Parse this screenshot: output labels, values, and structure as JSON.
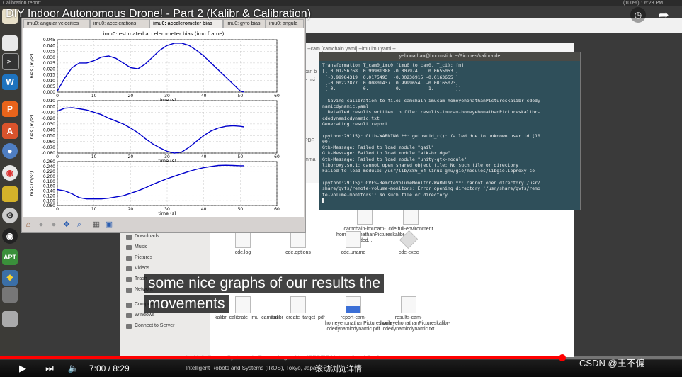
{
  "top_panel": {
    "title": "Calibration report",
    "right_status": "(100%)  ↕  6:23 PM"
  },
  "video": {
    "title": "DIY Indoor Autonomous Drone! - Part 2 (Kalibr & Calibration)",
    "subtitle_line1": "some nice graphs of our results the",
    "subtitle_line2": "movements",
    "time": "7:00 / 8:29",
    "progress": 0.825,
    "cn_caption": "滚动浏览详情",
    "watermark": "CSDN @王不偏"
  },
  "plot_window": {
    "tabs": [
      "imu0: angular velocities",
      "imu0: accelerations",
      "imu0: accelerometer bias",
      "imu0: gyro bias",
      "imu0: angula"
    ],
    "active_tab": 2,
    "toolbar_icons": [
      "home-icon",
      "back-icon",
      "forward-icon",
      "pan-icon",
      "zoom-icon",
      "subplots-icon",
      "save-icon"
    ]
  },
  "terminal": {
    "title": "yehonathan@boomstick: ~/Pictures/kalibr-cde",
    "lines": [
      "Transformation T_cam0_imu0 (imu0 to cam0, T_ci): [m]",
      "[[ 0.01756768  0.99981388 -0.007974    0.0655053 ]",
      " [-0.99984319  0.0175493  -0.00236915 -0.0163655 ]",
      " [-0.00222877  0.00801437  0.9999654  -0.00165073]",
      " [ 0.          0.          0.          1.        ]]",
      "",
      "  Saving calibration to file: camchain-imucam-homeyehonathanPictureskalibr-cdedy",
      "namicdynamic.yaml",
      "  Detailed results written to file: results-imucam-homeyehonathanPictureskalibr-",
      "cdedynamicdynamic.txt",
      "Generating result report...",
      "",
      "(python:29115): GLib-WARNING **: getpwuid_r(): failed due to unknown user id (10",
      "00)",
      "Gtk-Message: Failed to load module \"gail\"",
      "Gtk-Message: Failed to load module \"atk-bridge\"",
      "Gtk-Message: Failed to load module \"unity-gtk-module\"",
      "libproxy.so.1: cannot open shared object file: No such file or directory",
      "Failed to load module: /usr/lib/x86_64-linux-gnu/gio/modules/libgiolibproxy.so",
      "",
      "(python:29115): GVFS-RemoteVolumeMonitor-WARNING **: cannot open directory /usr/",
      "share/gvfs/remote-volume-monitors: Error opening directory '/usr/share/gvfs/remo",
      "te-volume-monitors': No such file or directory",
      "▌"
    ]
  },
  "file_manager": {
    "sidebar": [
      "Downloads",
      "Music",
      "Pictures",
      "Videos",
      "Trash",
      "Network",
      "Computer",
      "Windows",
      "Connect to Server"
    ],
    "files": [
      {
        "name": "camchain-imucam-homeyehonathanPictureskalibr-cded..."
      },
      {
        "name": "cde.full-environment"
      },
      {
        "name": "cde.log"
      },
      {
        "name": "cde.options"
      },
      {
        "name": "cde.uname"
      },
      {
        "name": "cde-exec"
      },
      {
        "name": "kalibr_calibrate_imu_camera"
      },
      {
        "name": "kalibr_create_target_pdf"
      },
      {
        "name": "report-cam-homeyehonathanPictureskalibr-cdedynamicdynamic.pdf"
      },
      {
        "name": "results-cam-homeyehonathanPictureskalibr-cdedynamicdynamic.txt"
      }
    ]
  },
  "web_snippets": [
    "--cam [camchain.yaml] --imu imu.yaml --",
    "can b",
    "e usi",
    "PDF",
    "mma"
  ],
  "footer_text": [
    "for Multi-Sensor Systems. In Proceedings of the IEEE/RSJ International Conference on",
    "Intelligent Robots and Systems (IROS), Tokyo, Japan"
  ],
  "chart_data": {
    "type": "line",
    "title": "imu0: estimated accelerometer bias (imu frame)",
    "color": "#0000cc",
    "subplots": [
      {
        "ylabel": "bias (m/s²)",
        "xlabel": "time (s)",
        "xlim": [
          0,
          60
        ],
        "ylim": [
          0.0,
          0.045
        ],
        "yticks": [
          0.0,
          0.005,
          0.01,
          0.015,
          0.02,
          0.025,
          0.03,
          0.035,
          0.04,
          0.045
        ],
        "xticks": [
          0,
          10,
          20,
          30,
          40,
          50,
          60
        ],
        "x": [
          0,
          2,
          4,
          6,
          8,
          10,
          12,
          14,
          16,
          18,
          20,
          22,
          24,
          26,
          28,
          30,
          32,
          34,
          36,
          38,
          40,
          42,
          44,
          46,
          48,
          50,
          51
        ],
        "y": [
          0.001,
          0.012,
          0.021,
          0.025,
          0.025,
          0.027,
          0.03,
          0.031,
          0.029,
          0.025,
          0.021,
          0.02,
          0.024,
          0.03,
          0.036,
          0.04,
          0.042,
          0.042,
          0.04,
          0.036,
          0.031,
          0.025,
          0.019,
          0.013,
          0.007,
          0.001,
          0.0
        ]
      },
      {
        "ylabel": "bias (m/s²)",
        "xlabel": "time (s)",
        "xlim": [
          0,
          60
        ],
        "ylim": [
          -0.08,
          0.01
        ],
        "yticks": [
          0.01,
          0.0,
          -0.01,
          -0.02,
          -0.03,
          -0.04,
          -0.05,
          -0.06,
          -0.07,
          -0.08
        ],
        "xticks": [
          0,
          10,
          20,
          30,
          40,
          50,
          60
        ],
        "x": [
          0,
          2,
          4,
          6,
          8,
          10,
          12,
          14,
          16,
          18,
          20,
          22,
          24,
          26,
          28,
          30,
          32,
          34,
          36,
          38,
          40,
          42,
          44,
          46,
          48,
          50,
          51
        ],
        "y": [
          -0.008,
          -0.003,
          -0.002,
          -0.004,
          -0.006,
          -0.01,
          -0.014,
          -0.02,
          -0.025,
          -0.03,
          -0.037,
          -0.045,
          -0.055,
          -0.064,
          -0.071,
          -0.077,
          -0.08,
          -0.078,
          -0.07,
          -0.06,
          -0.05,
          -0.042,
          -0.037,
          -0.034,
          -0.033,
          -0.034,
          -0.035
        ]
      },
      {
        "ylabel": "bias (m/s²)",
        "xlabel": "time (s)",
        "xlim": [
          0,
          60
        ],
        "ylim": [
          0.08,
          0.26
        ],
        "yticks": [
          0.08,
          0.1,
          0.12,
          0.14,
          0.16,
          0.18,
          0.2,
          0.22,
          0.24,
          0.26
        ],
        "xticks": [
          0,
          10,
          20,
          30,
          40,
          50,
          60
        ],
        "x": [
          0,
          2,
          4,
          6,
          8,
          10,
          12,
          14,
          16,
          18,
          20,
          22,
          24,
          26,
          28,
          30,
          32,
          34,
          36,
          38,
          40,
          42,
          44,
          46,
          48,
          50,
          51
        ],
        "y": [
          0.145,
          0.14,
          0.128,
          0.112,
          0.107,
          0.107,
          0.107,
          0.11,
          0.115,
          0.12,
          0.13,
          0.14,
          0.152,
          0.166,
          0.178,
          0.19,
          0.2,
          0.21,
          0.22,
          0.228,
          0.235,
          0.24,
          0.244,
          0.245,
          0.244,
          0.243,
          0.243
        ]
      }
    ]
  }
}
